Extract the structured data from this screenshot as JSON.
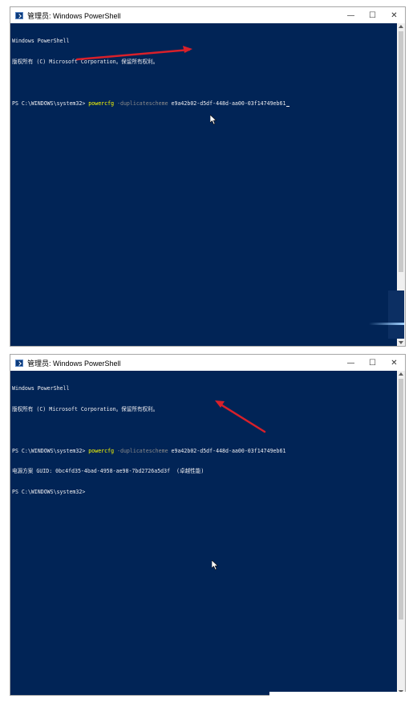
{
  "windows": [
    {
      "title": "管理员: Windows PowerShell",
      "controls": {
        "minimize": "—",
        "maximize": "☐",
        "close": "✕"
      },
      "console": {
        "banner_line1": "Windows PowerShell",
        "banner_line2": "版权所有 (C) Microsoft Corporation。保留所有权利。",
        "prompt": "PS C:\\WINDOWS\\system32> ",
        "command": "powercfg",
        "parameter": " -duplicatescheme",
        "argument": " e9a42b02-d5df-448d-aa00-03f14749eb61"
      }
    },
    {
      "title": "管理员: Windows PowerShell",
      "controls": {
        "minimize": "—",
        "maximize": "☐",
        "close": "✕"
      },
      "console": {
        "banner_line1": "Windows PowerShell",
        "banner_line2": "版权所有 (C) Microsoft Corporation。保留所有权利。",
        "prompt": "PS C:\\WINDOWS\\system32> ",
        "command": "powercfg",
        "parameter": " -duplicatescheme",
        "argument": " e9a42b02-d5df-448d-aa00-03f14749eb61",
        "output_line": "电源方案 GUID: 0bc4fd35-4bad-4958-ae98-7bd2726a5d3f  (卓越性能)",
        "prompt2": "PS C:\\WINDOWS\\system32>"
      }
    }
  ],
  "colors": {
    "console_bg": "#012456",
    "console_fg": "#eeedf0",
    "command": "#ffff00",
    "parameter": "#8a8a8a",
    "annotation_arrow": "#d8202a"
  }
}
